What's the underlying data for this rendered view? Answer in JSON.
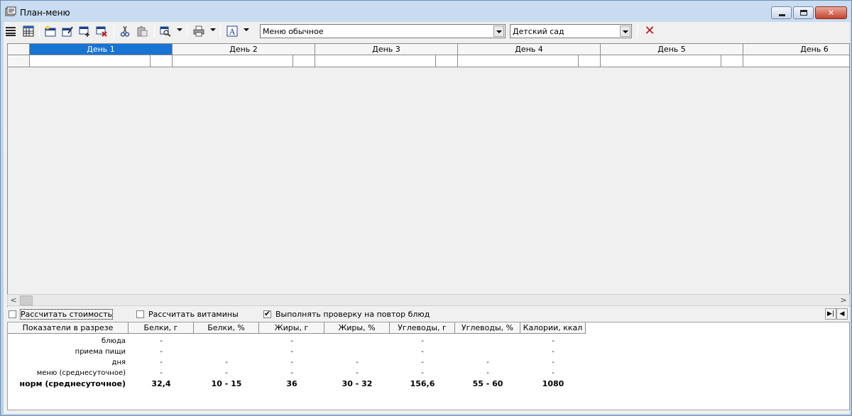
{
  "window": {
    "title": "План-меню",
    "buttons": [
      "minimize",
      "maximize",
      "close"
    ]
  },
  "toolbar": {
    "icons": [
      "list-icon",
      "table-icon",
      "add-day-icon",
      "edit-day-icon",
      "insert-icon",
      "delete-icon",
      "cut-icon",
      "paste-icon",
      "preview-icon",
      "print-icon",
      "font-icon",
      "close-red-icon"
    ],
    "menu_combo": "Меню обычное",
    "category_combo": "Детский сад"
  },
  "grid": {
    "days": [
      "День 1",
      "День 2",
      "День 3",
      "День 4",
      "День 5",
      "День 6"
    ],
    "selected_day": "День 1"
  },
  "options": {
    "calc_cost": "Рассчитать стоимость",
    "calc_vitamins": "Рассчитать витамины",
    "check_repeat": "Выполнять проверку на повтор блюд",
    "calc_cost_checked": false,
    "calc_vitamins_checked": false,
    "check_repeat_checked": true
  },
  "nutrition": {
    "headers": [
      "Показатели в разрезе",
      "Белки, г",
      "Белки, %",
      "Жиры, г",
      "Жиры, %",
      "Углеводы, г",
      "Углеводы, %",
      "Калории, ккал"
    ],
    "rows": [
      {
        "label": "блюда",
        "values": [
          "-",
          "",
          "-",
          "",
          "-",
          "",
          "-"
        ]
      },
      {
        "label": "приема пищи",
        "values": [
          "-",
          "",
          "-",
          "",
          "-",
          "",
          "-"
        ]
      },
      {
        "label": "дня",
        "values": [
          "-",
          "-",
          "-",
          "-",
          "-",
          "-",
          "-"
        ]
      },
      {
        "label": "меню (среднесуточное)",
        "values": [
          "-",
          "-",
          "-",
          "-",
          "-",
          "-",
          "-"
        ]
      },
      {
        "label": "норм (среднесуточное)",
        "values": [
          "32,4",
          "10 - 15",
          "36",
          "30 - 32",
          "156,6",
          "55 - 60",
          "1080"
        ]
      }
    ]
  },
  "colors": {
    "selected_header": "#1874d2",
    "close_mark": "#c0161b"
  }
}
